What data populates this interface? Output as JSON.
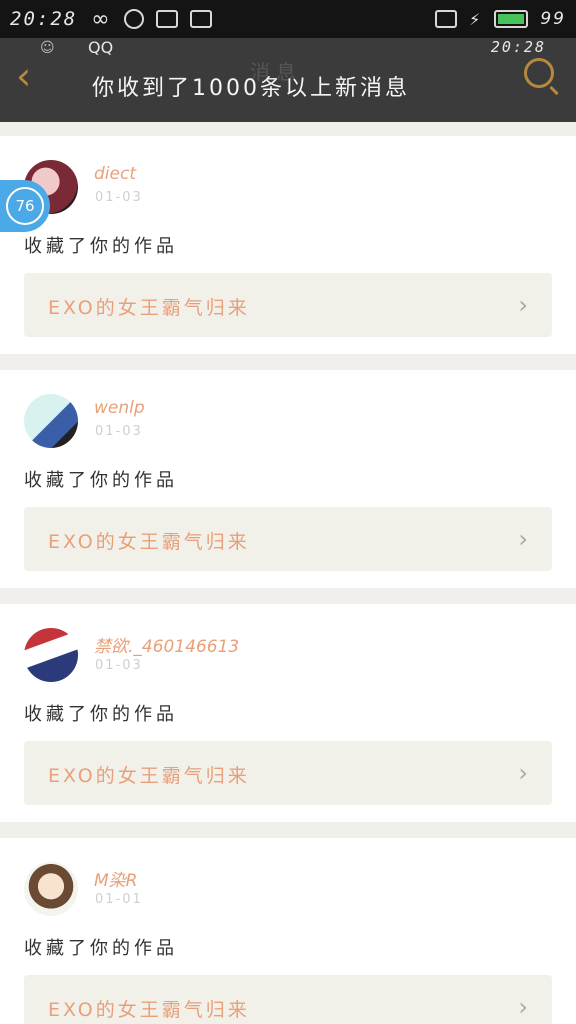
{
  "status_bar": {
    "time": "20:28",
    "battery_level": "99"
  },
  "header": {
    "title": "消息",
    "notification": {
      "app": "QQ",
      "time": "20:28",
      "message": "你收到了1000条以上新消息"
    }
  },
  "badge": {
    "count": "76"
  },
  "items": [
    {
      "user": "diect",
      "date": "01-03",
      "action": "收藏了你的作品",
      "work": "EXO的女王霸气归来"
    },
    {
      "user": "wenlp",
      "date": "01-03",
      "action": "收藏了你的作品",
      "work": "EXO的女王霸气归来"
    },
    {
      "user": "禁欲._460146613",
      "date": "01-03",
      "action": "收藏了你的作品",
      "work": "EXO的女王霸气归来"
    },
    {
      "user": "M染R",
      "date": "01-01",
      "action": "收藏了你的作品",
      "work": "EXO的女王霸气归来"
    }
  ],
  "colors": {
    "accent": "#e9a07a",
    "header_bg": "#3b3b3b",
    "badge": "#4aa9e6"
  },
  "icons": {
    "back": "back-arrow-icon",
    "search": "search-icon",
    "chevron": "chevron-right-icon"
  }
}
